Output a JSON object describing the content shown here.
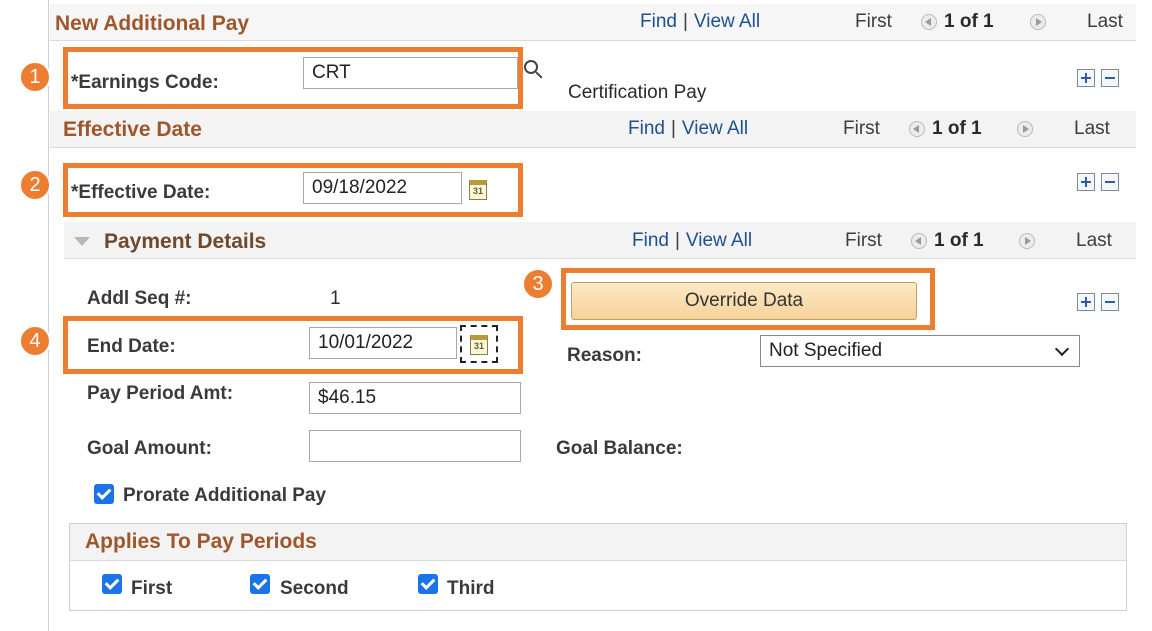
{
  "additional_pay": {
    "title": "New Additional Pay",
    "nav": {
      "find": "Find",
      "view_all": "View All",
      "first": "First",
      "count": "1 of 1",
      "last": "Last"
    },
    "earnings_code_label": "*Earnings Code:",
    "earnings_code_value": "CRT",
    "earnings_description": "Certification Pay"
  },
  "effective_date_section": {
    "title": "Effective Date",
    "nav": {
      "find": "Find",
      "view_all": "View All",
      "first": "First",
      "count": "1 of 1",
      "last": "Last"
    },
    "effective_date_label": "*Effective Date:",
    "effective_date_value": "09/18/2022"
  },
  "payment_details": {
    "title": "Payment Details",
    "nav": {
      "find": "Find",
      "view_all": "View All",
      "first": "First",
      "count": "1 of 1",
      "last": "Last"
    },
    "addl_seq_label": "Addl Seq #:",
    "addl_seq_value": "1",
    "override_button": "Override Data",
    "end_date_label": "End Date:",
    "end_date_value": "10/01/2022",
    "reason_label": "Reason:",
    "reason_value": "Not Specified",
    "pay_period_amt_label": "Pay Period Amt:",
    "pay_period_amt_value": "$46.15",
    "goal_amount_label": "Goal Amount:",
    "goal_amount_value": "",
    "goal_balance_label": "Goal Balance:",
    "prorate_label": "Prorate Additional Pay"
  },
  "applies_to_pay_periods": {
    "title": "Applies To Pay Periods",
    "first": "First",
    "second": "Second",
    "third": "Third"
  },
  "calendar_glyph": "31",
  "callouts": [
    "1",
    "2",
    "3",
    "4"
  ],
  "colors": {
    "callout": "#ed7d31",
    "section_title": "#a0562b",
    "link": "#1d4f91",
    "checkbox": "#1a73e8"
  }
}
